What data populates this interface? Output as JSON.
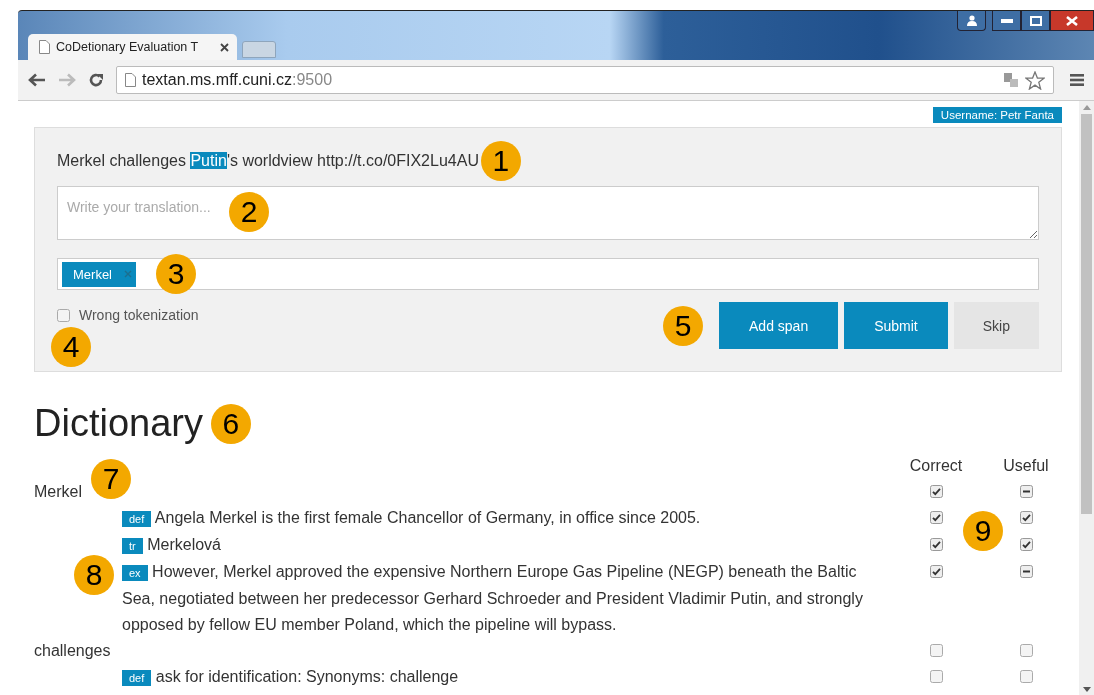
{
  "browser": {
    "tab_title": "CoDetionary Evaluation T",
    "url_host": "textan.ms.mff.cuni.cz",
    "url_port": ":9500"
  },
  "user_badge": "Username: Petr Fanta",
  "task": {
    "sentence_parts": [
      {
        "text": "Merkel challenges ",
        "highlighted": false
      },
      {
        "text": "Putin",
        "highlighted": true
      },
      {
        "text": "'s worldview http://t.co/0FIX2Lu4AU",
        "highlighted": false
      }
    ],
    "callout": "1"
  },
  "translation": {
    "placeholder": "Write your translation...",
    "callout": "2"
  },
  "spans": {
    "tags": [
      {
        "label": "Merkel"
      }
    ],
    "callout": "3"
  },
  "wrong_tokenization": {
    "label": "Wrong tokenization",
    "checked": false,
    "callout": "4"
  },
  "buttons": [
    {
      "label": "Add span",
      "kind": "primary"
    },
    {
      "label": "Submit",
      "kind": "primary"
    },
    {
      "label": "Skip",
      "kind": "secondary"
    }
  ],
  "buttons_callout": "5",
  "dictionary": {
    "title": "Dictionary",
    "callout": "6",
    "columns": [
      "Correct",
      "Useful"
    ],
    "entries": [
      {
        "word": "Merkel",
        "callout": "7",
        "correct": {
          "kind": "tick"
        },
        "useful": {
          "kind": "dash"
        },
        "senses": [
          {
            "type": "def",
            "text": "Angela Merkel is the first female Chancellor of Germany, in office since 2005.",
            "correct": {
              "kind": "tick"
            },
            "useful": {
              "kind": "tick"
            },
            "check_callout": "9"
          },
          {
            "type": "tr",
            "text": "Merkelová",
            "correct": {
              "kind": "tick"
            },
            "useful": {
              "kind": "tick"
            }
          },
          {
            "type": "ex",
            "text": "However, Merkel approved the expensive Northern Europe Gas Pipeline (NEGP) beneath the Baltic Sea, negotiated between her predecessor Gerhard Schroeder and President Vladimir Putin, and strongly opposed by fellow EU member Poland, which the pipeline will bypass.",
            "correct": {
              "kind": "tick"
            },
            "useful": {
              "kind": "dash"
            },
            "callout": "8"
          }
        ]
      },
      {
        "word": "challenges",
        "correct": {
          "kind": "empty"
        },
        "useful": {
          "kind": "empty"
        },
        "senses": [
          {
            "type": "def",
            "text": "ask for identification: Synonyms: challenge",
            "correct": {
              "kind": "empty"
            },
            "useful": {
              "kind": "empty"
            }
          }
        ]
      }
    ]
  }
}
